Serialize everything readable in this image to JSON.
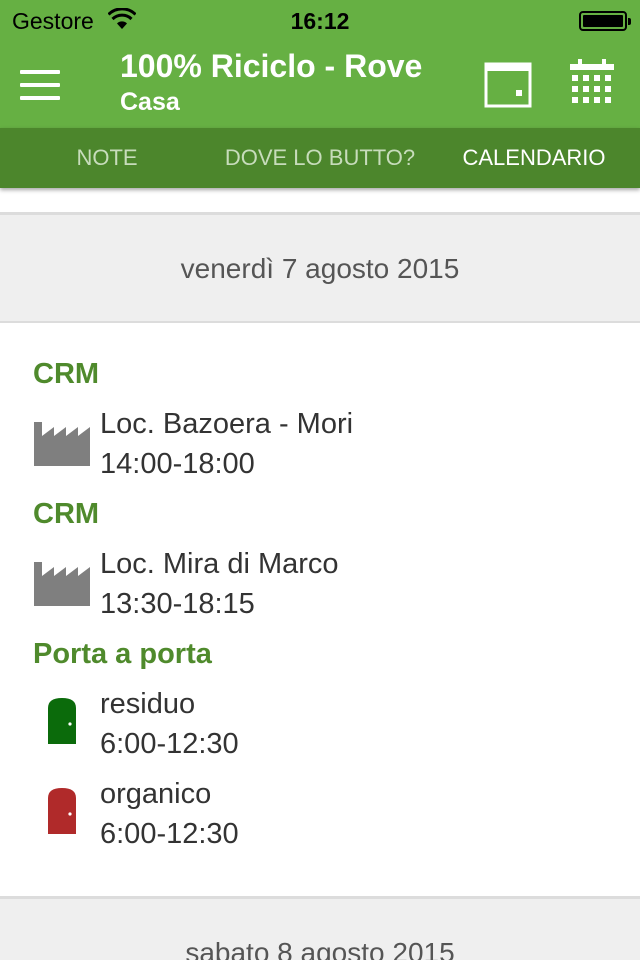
{
  "status_bar": {
    "carrier": "Gestore",
    "time": "16:12"
  },
  "app_bar": {
    "title": "100% Riciclo - Rove",
    "subtitle": "Casa"
  },
  "tabs": [
    {
      "label": "NOTE",
      "active": false
    },
    {
      "label": "DOVE LO BUTTO?",
      "active": false
    },
    {
      "label": "CALENDARIO",
      "active": true
    }
  ],
  "days": [
    {
      "date": "venerdì 7 agosto 2015",
      "groups": [
        {
          "title": "CRM",
          "icon": "factory-icon",
          "place": "Loc. Bazoera - Mori",
          "hours": "14:00-18:00"
        },
        {
          "title": "CRM",
          "icon": "factory-icon",
          "place": "Loc. Mira di Marco",
          "hours": "13:30-18:15"
        },
        {
          "title": "Porta a porta",
          "items": [
            {
              "icon": "door-icon",
              "color": "#0b6b0b",
              "name": "residuo",
              "hours": "6:00-12:30"
            },
            {
              "icon": "door-icon",
              "color": "#b02a2a",
              "name": "organico",
              "hours": "6:00-12:30"
            }
          ]
        }
      ]
    },
    {
      "date": "sabato 8 agosto 2015"
    }
  ],
  "colors": {
    "primary": "#66b043",
    "tab_bar": "#4c862c",
    "accent_text": "#4f8a2c"
  }
}
